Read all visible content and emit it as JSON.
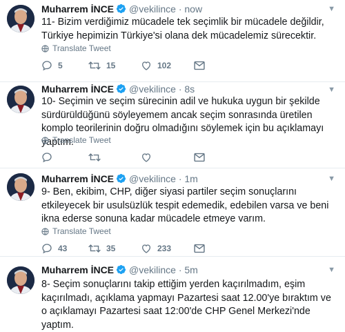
{
  "tweets": [
    {
      "name": "Muharrem İNCE",
      "handle": "@vekilince",
      "time": "· now",
      "text": "11- Bizim verdiğimiz mücadele tek seçimlik bir mücadele değildir, Türkiye hepimizin Türkiye'si olana dek mücadelemiz sürecektir.",
      "translate": "Translate Tweet",
      "replies": "5",
      "retweets": "15",
      "likes": "102"
    },
    {
      "name": "Muharrem İNCE",
      "handle": "@vekilince",
      "time": "· 8s",
      "text": "10- Seçimin ve seçim sürecinin adil ve hukuka uygun bir şekilde sürdürüldüğünü söyleyemem ancak seçim sonrasında üretilen komplo teorilerinin doğru olmadığını söylemek için bu açıklamayı yaptım.",
      "translate": "Translate Tweet",
      "replies": "",
      "retweets": "",
      "likes": ""
    },
    {
      "name": "Muharrem İNCE",
      "handle": "@vekilince",
      "time": "· 1m",
      "text": "9- Ben, ekibim, CHP, diğer siyasi partiler seçim sonuçlarını etkileyecek bir usulsüzlük tespit edemedik, edebilen varsa ve beni ikna ederse sonuna kadar mücadele etmeye varım.",
      "translate": "Translate Tweet",
      "replies": "43",
      "retweets": "35",
      "likes": "233"
    },
    {
      "name": "Muharrem İNCE",
      "handle": "@vekilince",
      "time": "· 5m",
      "text": "8- Seçim sonuçlarını takip ettiğim yerden kaçırılmadım, eşim kaçırılmadı, açıklama yapmayı Pazartesi saat 12.00'ye bıraktım ve o açıklamayı Pazartesi saat 12:00'de CHP Genel Merkezi'nde yaptım."
    }
  ],
  "colors": {
    "verified": "#1da1f2",
    "muted": "#657786",
    "text": "#14171a"
  },
  "icons": [
    "verified-badge-icon",
    "globe-icon",
    "reply-icon",
    "retweet-icon",
    "like-icon",
    "message-icon",
    "caret-down-icon"
  ]
}
